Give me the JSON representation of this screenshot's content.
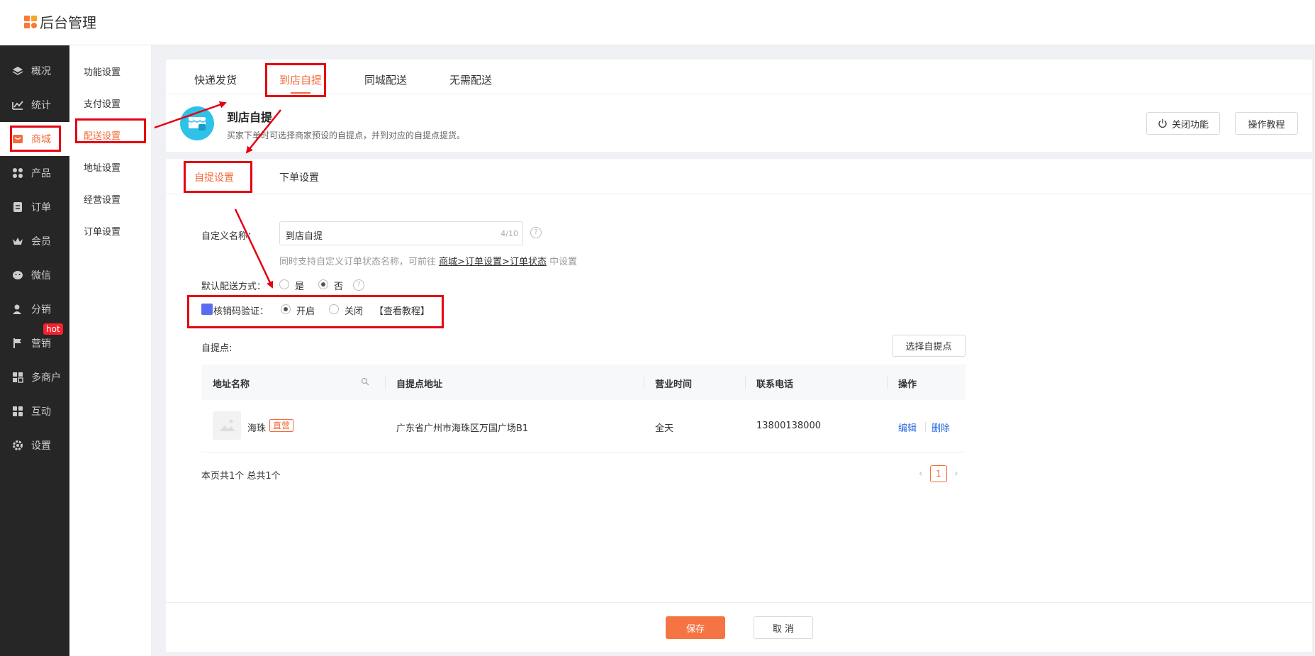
{
  "app": {
    "title": "后台管理"
  },
  "sidebar": {
    "items": [
      {
        "label": "概况",
        "icon": "layers-icon"
      },
      {
        "label": "统计",
        "icon": "chart-icon"
      },
      {
        "label": "商城",
        "icon": "shop-icon",
        "active": true
      },
      {
        "label": "产品",
        "icon": "grid-icon"
      },
      {
        "label": "订单",
        "icon": "order-icon"
      },
      {
        "label": "会员",
        "icon": "crown-icon"
      },
      {
        "label": "微信",
        "icon": "wechat-icon"
      },
      {
        "label": "分销",
        "icon": "user-share-icon"
      },
      {
        "label": "营销",
        "icon": "flag-icon",
        "badge": "hot"
      },
      {
        "label": "多商户",
        "icon": "multi-shop-icon"
      },
      {
        "label": "互动",
        "icon": "interact-icon"
      },
      {
        "label": "设置",
        "icon": "gear-icon"
      }
    ]
  },
  "subnav": {
    "items": [
      {
        "label": "功能设置"
      },
      {
        "label": "支付设置"
      },
      {
        "label": "配送设置",
        "active": true
      },
      {
        "label": "地址设置"
      },
      {
        "label": "经营设置"
      },
      {
        "label": "订单设置"
      }
    ]
  },
  "delivery_tabs": [
    "快递发货",
    "到店自提",
    "同城配送",
    "无需配送"
  ],
  "hero": {
    "title": "到店自提",
    "desc": "买家下单时可选择商家预设的自提点，并到对应的自提点提货。",
    "close_btn": "关闭功能",
    "tutorial_btn": "操作教程"
  },
  "settings_tabs": [
    "自提设置",
    "下单设置"
  ],
  "form": {
    "name_label": "自定义名称：",
    "name_value": "到店自提",
    "name_count": "4/10",
    "hint_prefix": "同时支持自定义订单状态名称，可前往",
    "hint_link": "商城>订单设置>订单状态",
    "hint_suffix": "中设置",
    "default_label": "默认配送方式：",
    "default_yes": "是",
    "default_no": "否",
    "verify_label": "核销码验证：",
    "verify_on": "开启",
    "verify_off": "关闭",
    "verify_tutorial": "【查看教程】",
    "pickup_label": "自提点:",
    "select_btn": "选择自提点"
  },
  "table": {
    "headers": [
      "地址名称",
      "自提点地址",
      "营业时间",
      "联系电话",
      "操作"
    ],
    "rows": [
      {
        "name": "海珠",
        "tag": "直营",
        "address": "广东省广州市海珠区万国广场B1",
        "hours": "全天",
        "phone": "13800138000",
        "edit": "编辑",
        "delete": "删除"
      }
    ],
    "summary": "本页共1个 总共1个",
    "page": "1"
  },
  "footer": {
    "save": "保存",
    "cancel": "取 消"
  },
  "colors": {
    "accent": "#f26b3a",
    "annotation_red": "#e60012",
    "sidebar_bg": "#262626"
  }
}
